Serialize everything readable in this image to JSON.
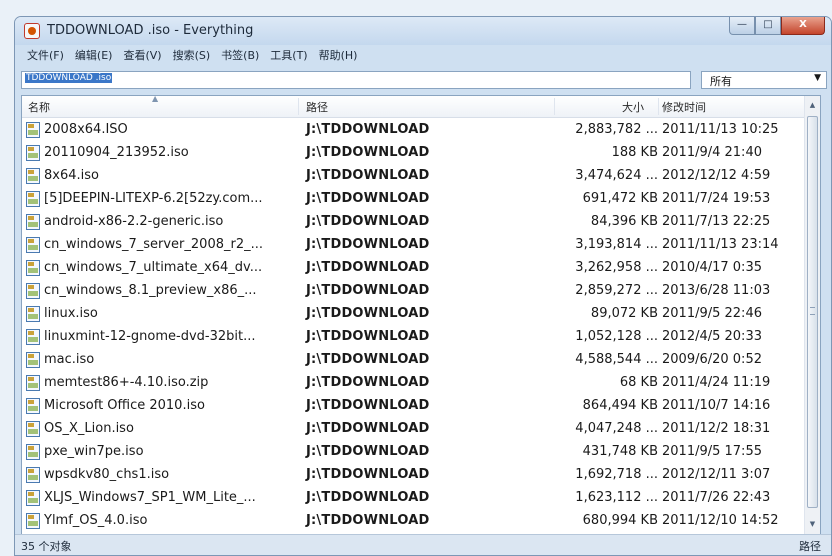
{
  "window": {
    "title": "TDDOWNLOAD .iso - Everything",
    "controls": {
      "minimize": "—",
      "maximize": "□",
      "close": "X"
    }
  },
  "menu": [
    "文件(F)",
    "编辑(E)",
    "查看(V)",
    "搜索(S)",
    "书签(B)",
    "工具(T)",
    "帮助(H)"
  ],
  "search": {
    "value": "TDDOWNLOAD .iso"
  },
  "filter": {
    "selected": "所有"
  },
  "columns": {
    "name": "名称",
    "path": "路径",
    "size": "大小",
    "modified": "修改时间"
  },
  "files": [
    {
      "name": "2008x64.ISO",
      "path": "J:\\TDDOWNLOAD",
      "size": "2,883,782 ...",
      "modified": "2011/11/13 10:25"
    },
    {
      "name": "20110904_213952.iso",
      "path": "J:\\TDDOWNLOAD",
      "size": "188 KB",
      "modified": "2011/9/4 21:40"
    },
    {
      "name": "8x64.iso",
      "path": "J:\\TDDOWNLOAD",
      "size": "3,474,624 ...",
      "modified": "2012/12/12 4:59"
    },
    {
      "name": "[5]DEEPIN-LITEXP-6.2[52zy.com...",
      "path": "J:\\TDDOWNLOAD",
      "size": "691,472 KB",
      "modified": "2011/7/24 19:53"
    },
    {
      "name": "android-x86-2.2-generic.iso",
      "path": "J:\\TDDOWNLOAD",
      "size": "84,396 KB",
      "modified": "2011/7/13 22:25"
    },
    {
      "name": "cn_windows_7_server_2008_r2_...",
      "path": "J:\\TDDOWNLOAD",
      "size": "3,193,814 ...",
      "modified": "2011/11/13 23:14"
    },
    {
      "name": "cn_windows_7_ultimate_x64_dv...",
      "path": "J:\\TDDOWNLOAD",
      "size": "3,262,958 ...",
      "modified": "2010/4/17 0:35"
    },
    {
      "name": "cn_windows_8.1_preview_x86_...",
      "path": "J:\\TDDOWNLOAD",
      "size": "2,859,272 ...",
      "modified": "2013/6/28 11:03"
    },
    {
      "name": "linux.iso",
      "path": "J:\\TDDOWNLOAD",
      "size": "89,072 KB",
      "modified": "2011/9/5 22:46"
    },
    {
      "name": "linuxmint-12-gnome-dvd-32bit...",
      "path": "J:\\TDDOWNLOAD",
      "size": "1,052,128 ...",
      "modified": "2012/4/5 20:33"
    },
    {
      "name": "mac.iso",
      "path": "J:\\TDDOWNLOAD",
      "size": "4,588,544 ...",
      "modified": "2009/6/20 0:52"
    },
    {
      "name": "memtest86+-4.10.iso.zip",
      "path": "J:\\TDDOWNLOAD",
      "size": "68 KB",
      "modified": "2011/4/24 11:19"
    },
    {
      "name": "Microsoft Office 2010.iso",
      "path": "J:\\TDDOWNLOAD",
      "size": "864,494 KB",
      "modified": "2011/10/7 14:16"
    },
    {
      "name": "OS_X_Lion.iso",
      "path": "J:\\TDDOWNLOAD",
      "size": "4,047,248 ...",
      "modified": "2011/12/2 18:31"
    },
    {
      "name": "pxe_win7pe.iso",
      "path": "J:\\TDDOWNLOAD",
      "size": "431,748 KB",
      "modified": "2011/9/5 17:55"
    },
    {
      "name": "wpsdkv80_chs1.iso",
      "path": "J:\\TDDOWNLOAD",
      "size": "1,692,718 ...",
      "modified": "2012/12/11 3:07"
    },
    {
      "name": "XLJS_Windows7_SP1_WM_Lite_...",
      "path": "J:\\TDDOWNLOAD",
      "size": "1,623,112 ...",
      "modified": "2011/7/26 22:43"
    },
    {
      "name": "Ylmf_OS_4.0.iso",
      "path": "J:\\TDDOWNLOAD",
      "size": "680,994 KB",
      "modified": "2011/12/10 14:52"
    }
  ],
  "status": {
    "count": "35 个对象",
    "right": "路径"
  },
  "colors": {
    "titlebar": "#c4d8ee",
    "selection": "#3b77c8",
    "close": "#c4452c"
  }
}
